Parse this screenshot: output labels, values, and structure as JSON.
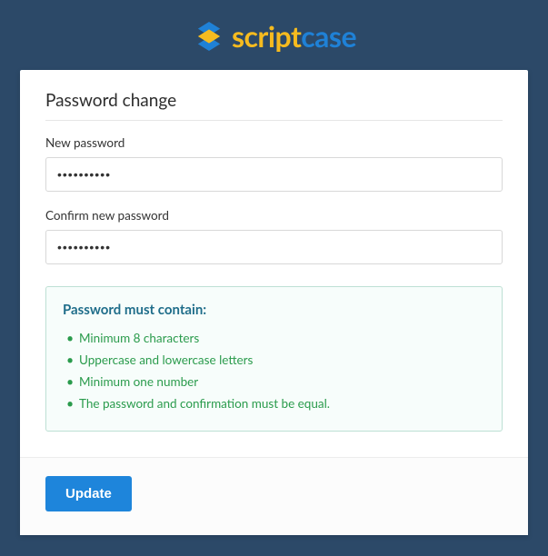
{
  "logo": {
    "part1": "script",
    "part2": "case"
  },
  "card": {
    "title": "Password change",
    "new_password_label": "New password",
    "new_password_value": "••••••••••",
    "confirm_label": "Confirm new password",
    "confirm_value": "••••••••••"
  },
  "rules": {
    "title": "Password must contain:",
    "items": [
      "Minimum 8 characters",
      "Uppercase and lowercase letters",
      "Minimum one number",
      "The password and confirmation must be equal."
    ]
  },
  "footer": {
    "update_label": "Update"
  }
}
